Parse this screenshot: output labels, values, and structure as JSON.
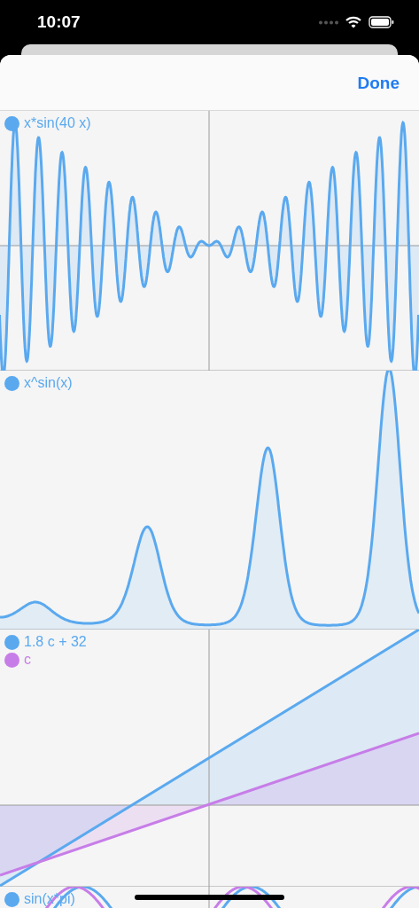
{
  "status_bar": {
    "time": "10:07"
  },
  "header": {
    "done_button": "Done"
  },
  "plots": [
    {
      "kind": "oscillating",
      "legend": [
        {
          "label": "x*sin(40 x)",
          "color": "#5aa9ef"
        }
      ]
    },
    {
      "kind": "peaks",
      "legend": [
        {
          "label": "x^sin(x)",
          "color": "#5aa9ef"
        }
      ]
    },
    {
      "kind": "linear",
      "legend": [
        {
          "label": "1.8 c + 32",
          "color": "#5aa9ef"
        },
        {
          "label": "c",
          "color": "#c77de8"
        }
      ]
    },
    {
      "kind": "sine",
      "legend": [
        {
          "label": "sin(x*pi)",
          "color": "#5aa9ef"
        }
      ]
    }
  ]
}
